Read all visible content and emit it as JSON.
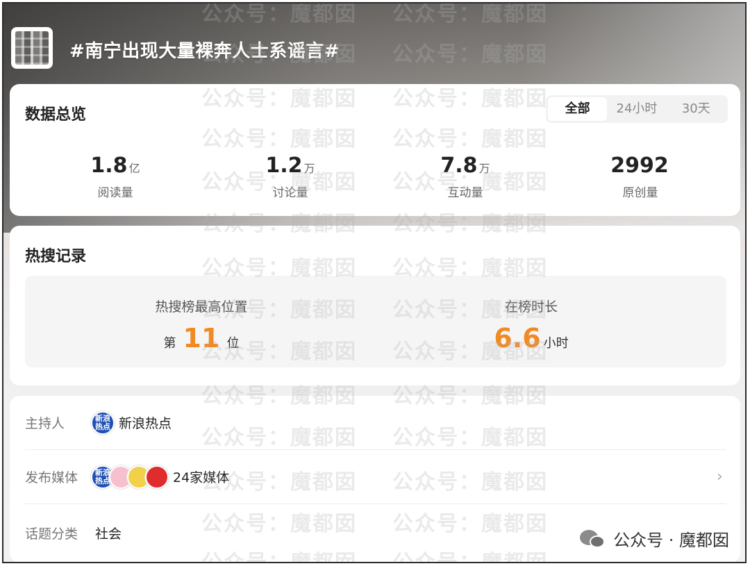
{
  "topic": {
    "title": "#南宁出现大量裸奔人士系谣言#",
    "thumbnail_icon": "topic-thumbnail-image"
  },
  "overview": {
    "title": "数据总览",
    "tabs": [
      "全部",
      "24小时",
      "30天"
    ],
    "active_tab": "全部",
    "stats": [
      {
        "value": "1.8",
        "unit": "亿",
        "label": "阅读量"
      },
      {
        "value": "1.2",
        "unit": "万",
        "label": "讨论量"
      },
      {
        "value": "7.8",
        "unit": "万",
        "label": "互动量"
      },
      {
        "value": "2992",
        "unit": "",
        "label": "原创量"
      }
    ]
  },
  "hot_search": {
    "title": "热搜记录",
    "rank_label": "热搜榜最高位置",
    "rank_prefix": "第",
    "rank_value": "11",
    "rank_suffix": "位",
    "duration_label": "在榜时长",
    "duration_value": "6.6",
    "duration_unit": "小时",
    "accent_color": "#f08a24"
  },
  "info": {
    "host_key": "主持人",
    "host_logo_text": "新浪热点",
    "host_name": "新浪热点",
    "media_key": "发布媒体",
    "media_count": "24家媒体",
    "category_key": "话题分类",
    "category_value": "社会"
  },
  "brand": {
    "text": "公众号 · 魔都囡"
  },
  "watermark": {
    "text": "公众号：魔都囡"
  }
}
